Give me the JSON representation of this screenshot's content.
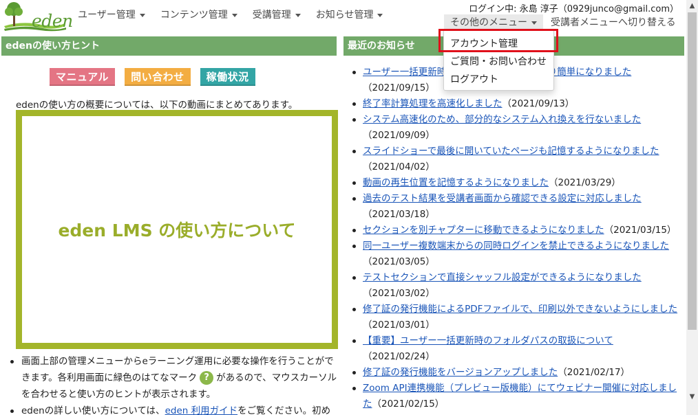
{
  "brand": {
    "logo_text": "eden",
    "logo_color": "#5a9a32"
  },
  "nav": [
    "ユーザー管理",
    "コンテンツ管理",
    "受講管理",
    "お知らせ管理"
  ],
  "login_info": "ログイン中: 永島 淳子（0929junco@gmail.com）",
  "other_menu": {
    "label": "その他のメニュー",
    "items": [
      "アカウント管理",
      "ご質問・お問い合わせ",
      "ログアウト"
    ]
  },
  "switch_menu": "受講者メニューへ切り替える",
  "left_panel": {
    "title": "edenの使い方ヒント",
    "buttons": [
      {
        "label": "マニュアル",
        "color": "#e47584"
      },
      {
        "label": "問い合わせ",
        "color": "#f3ad42"
      },
      {
        "label": "稼働状況",
        "color": "#33a5a5"
      }
    ],
    "overview_text": "edenの使い方の概要については、以下の動画にまとめてあります。",
    "video_title": "eden LMS の使い方について",
    "bullet1_before": "画面上部の管理メニューからeラーニング運用に必要な操作を行うことができます。各利用画面に緑色のはてなマーク",
    "bullet1_icon": "?",
    "bullet1_after": "があるので、マウスカーソルを合わせると使い方のヒントが表示されます。",
    "bullet2_before": "edenの詳しい使い方については、",
    "bullet2_link": "eden 利用ガイド",
    "bullet2_after": "をご覧ください。初め"
  },
  "right_panel": {
    "title": "最近のお知らせ",
    "news": [
      {
        "title": "ユーザー一括更新時のフォルダパス指定がより簡単になりました",
        "date": "（2021/09/15）"
      },
      {
        "title": "終了率計算処理を高速化しました",
        "date": "（2021/09/13）"
      },
      {
        "title": "システム高速化のため、部分的なシステム入れ換えを行ないました",
        "date": "（2021/09/09）"
      },
      {
        "title": "スライドショーで最後に開いていたページも記憶するようになりました",
        "date": "（2021/04/02）"
      },
      {
        "title": "動画の再生位置を記憶するようになりました",
        "date": "（2021/03/29）"
      },
      {
        "title": "過去のテスト結果を受講者画面から確認できる設定に対応しました",
        "date": "（2021/03/18）"
      },
      {
        "title": "セクションを別チャプターに移動できるようになりました",
        "date": "（2021/03/15）"
      },
      {
        "title": "同一ユーザー複数端末からの同時ログインを禁止できるようになりました",
        "date": "（2021/03/05）"
      },
      {
        "title": "テストセクションで直接シャッフル設定ができるようになりました",
        "date": "（2021/03/02）"
      },
      {
        "title": "修了証の発行機能によるPDFファイルで、印刷以外できないようにしました",
        "date": "（2021/03/01）"
      },
      {
        "title": "【重要】ユーザー一括更新時のフォルダパスの取扱について",
        "date": "（2021/02/24）"
      },
      {
        "title": "修了証の発行機能をバージョンアップしました",
        "date": "（2021/02/17）"
      },
      {
        "title": "Zoom API連携機能（プレビュー版機能）にてウェビナー開催に対応しました",
        "date": "（2021/02/15）"
      }
    ]
  },
  "colors": {
    "header_green": "#72a969",
    "link_blue": "#1a55b8",
    "video_border": "#a3b52a",
    "highlight_red": "#e0101a"
  }
}
